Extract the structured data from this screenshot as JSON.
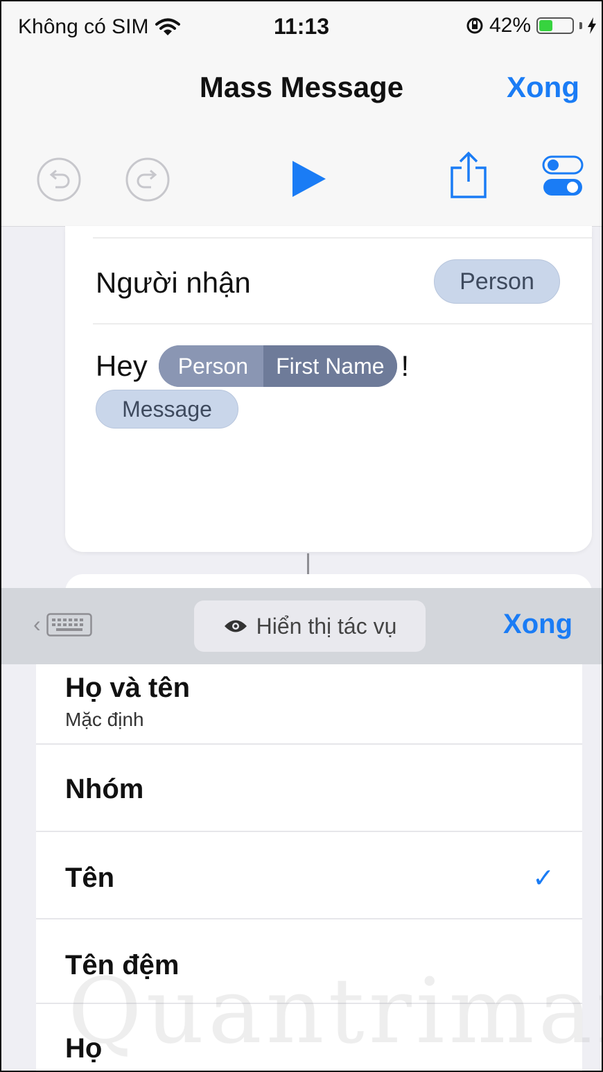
{
  "status_bar": {
    "carrier": "Không có SIM",
    "time": "11:13",
    "battery_percent": "42%",
    "battery_level": 0.42,
    "battery_color": "#37d33f"
  },
  "nav": {
    "title": "Mass Message",
    "done_label": "Xong"
  },
  "toolbar": {
    "undo_icon": "undo-icon",
    "redo_icon": "redo-icon",
    "run_icon": "play-icon",
    "share_icon": "share-icon",
    "settings_icon": "toggle-settings-icon",
    "accent_color": "#1a7cf5"
  },
  "card": {
    "recipient_label": "Người nhận",
    "recipient_value": "Person",
    "message_prefix": "Hey",
    "variable_source": "Person",
    "variable_property": "First Name",
    "message_suffix": "!",
    "message_variable": "Message"
  },
  "accessory": {
    "keyboard_icon": "keyboard-icon",
    "show_actions_label": "Hiển thị tác vụ",
    "done_label": "Xong"
  },
  "list": {
    "items": [
      {
        "title": "Họ và tên",
        "subtitle": "Mặc định",
        "selected": false
      },
      {
        "title": "Nhóm",
        "subtitle": "",
        "selected": false
      },
      {
        "title": "Tên",
        "subtitle": "",
        "selected": true
      },
      {
        "title": "Tên đệm",
        "subtitle": "",
        "selected": false
      },
      {
        "title": "Họ",
        "subtitle": "",
        "selected": false
      }
    ]
  },
  "watermark": "Quantrimang"
}
